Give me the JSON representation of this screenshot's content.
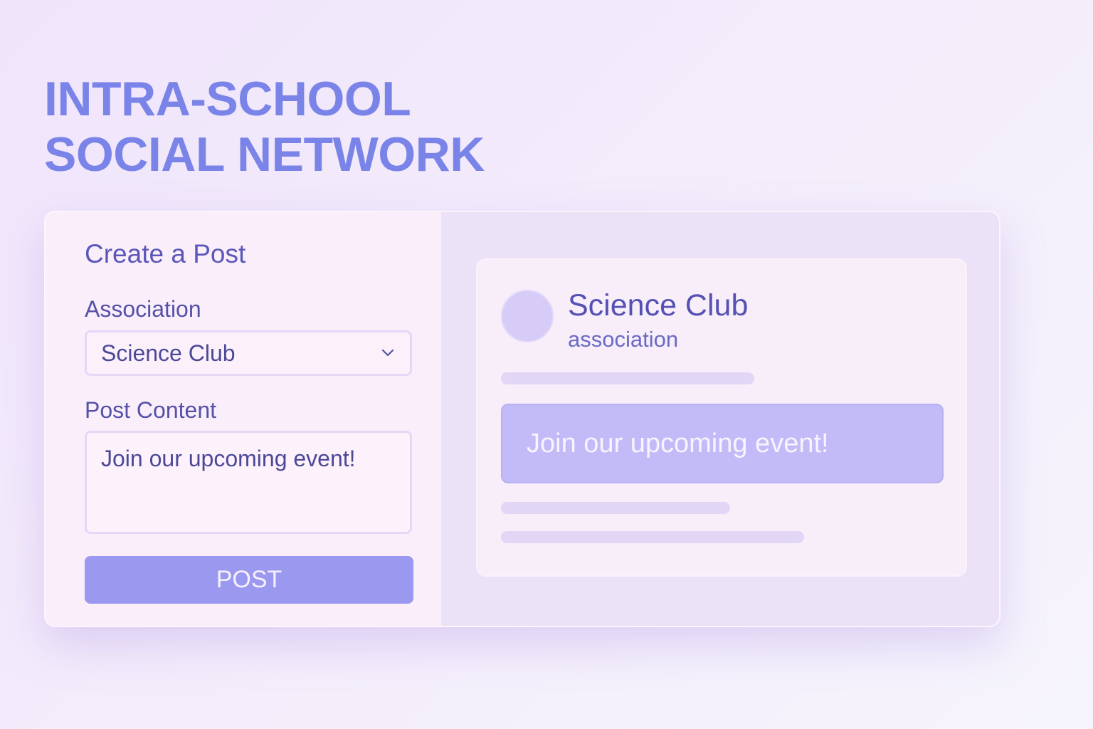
{
  "page": {
    "title": "INTRA-SCHOOL\nSOCIAL NETWORK"
  },
  "composer": {
    "heading": "Create a Post",
    "association_label": "Association",
    "association_selected": "Science Club",
    "content_label": "Post Content",
    "content_value": "Join our upcoming event!",
    "post_button_label": "POST"
  },
  "preview": {
    "association_name": "Science Club",
    "association_type": "association",
    "post_text": "Join our upcoming event!"
  },
  "icons": {
    "select_chevron": "chevron-down-icon"
  },
  "colors": {
    "accent": "#7a84e8",
    "button": "#9b98ef",
    "banner": "#c2bbf8",
    "text_primary": "#5550b3"
  }
}
